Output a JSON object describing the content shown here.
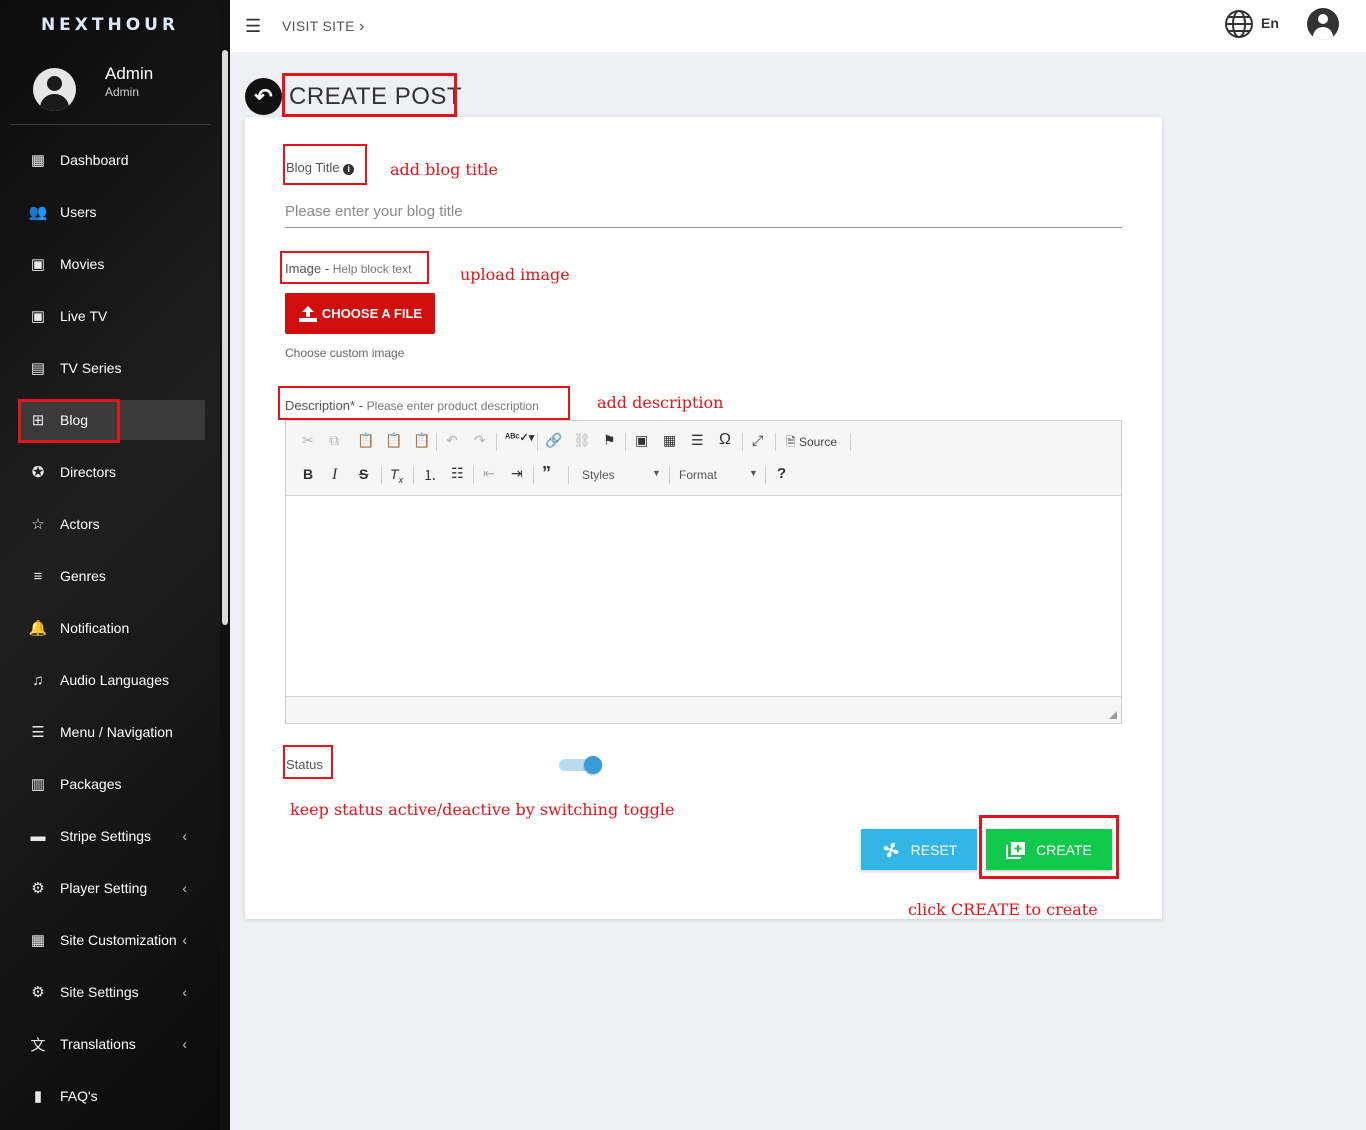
{
  "app": {
    "brand": "NEXTHOUR"
  },
  "profile": {
    "name": "Admin",
    "role": "Admin"
  },
  "sidebar": {
    "items": [
      {
        "label": "Dashboard",
        "icon": "dashboard-icon",
        "glyph": "▦",
        "chevron": false
      },
      {
        "label": "Users",
        "icon": "users-icon",
        "glyph": "👥",
        "chevron": false
      },
      {
        "label": "Movies",
        "icon": "movies-icon",
        "glyph": "▣",
        "chevron": false
      },
      {
        "label": "Live TV",
        "icon": "live-tv-icon",
        "glyph": "▣",
        "chevron": false
      },
      {
        "label": "TV Series",
        "icon": "tv-series-icon",
        "glyph": "▤",
        "chevron": false
      },
      {
        "label": "Blog",
        "icon": "blog-icon",
        "glyph": "⊞",
        "chevron": false,
        "active": true
      },
      {
        "label": "Directors",
        "icon": "directors-icon",
        "glyph": "✪",
        "chevron": false
      },
      {
        "label": "Actors",
        "icon": "actors-icon",
        "glyph": "☆",
        "chevron": false
      },
      {
        "label": "Genres",
        "icon": "genres-icon",
        "glyph": "≡",
        "chevron": false
      },
      {
        "label": "Notification",
        "icon": "notification-icon",
        "glyph": "🔔",
        "chevron": false
      },
      {
        "label": "Audio Languages",
        "icon": "audio-languages-icon",
        "glyph": "♫",
        "chevron": false
      },
      {
        "label": "Menu / Navigation",
        "icon": "menu-icon",
        "glyph": "☰",
        "chevron": false
      },
      {
        "label": "Packages",
        "icon": "packages-icon",
        "glyph": "▥",
        "chevron": false
      },
      {
        "label": "Stripe Settings",
        "icon": "stripe-icon",
        "glyph": "▬",
        "chevron": true
      },
      {
        "label": "Player Setting",
        "icon": "player-gear-icon",
        "glyph": "⚙",
        "chevron": true
      },
      {
        "label": "Site Customization",
        "icon": "site-customization-icon",
        "glyph": "▦",
        "chevron": true
      },
      {
        "label": "Site Settings",
        "icon": "site-gear-icon",
        "glyph": "⚙",
        "chevron": true
      },
      {
        "label": "Translations",
        "icon": "translate-icon",
        "glyph": "文",
        "chevron": true
      },
      {
        "label": "FAQ's",
        "icon": "faq-icon",
        "glyph": "▮",
        "chevron": false
      }
    ],
    "chevron_glyph": "‹"
  },
  "topbar": {
    "visit_site": "VISIT SITE",
    "visit_chevron": "›",
    "language": "En"
  },
  "page": {
    "title": "CREATE POST"
  },
  "form": {
    "blog_title_label": "Blog Title",
    "blog_title_placeholder": "Please enter your blog title",
    "image_label": "Image",
    "image_help_sep": " - ",
    "image_help": "Help block text",
    "file_button": "CHOOSE A FILE",
    "file_help": "Choose custom image",
    "description_label": "Description*",
    "description_help_sep": " - ",
    "description_help": "Please enter product description",
    "status_label": "Status",
    "status_active": true,
    "reset_label": "RESET",
    "create_label": "CREATE"
  },
  "editor": {
    "source_label": "Source",
    "styles_label": "Styles",
    "format_label": "Format",
    "help_glyph": "?"
  },
  "annotations": {
    "blog_title": "add blog title",
    "image": "upload image",
    "description": "add description",
    "status": "keep status active/deactive by switching toggle",
    "create": "click CREATE to create"
  },
  "colors": {
    "accent_red": "#e3141b",
    "reset_blue": "#33b5e5",
    "create_green": "#10c94b",
    "file_red": "#d10d0d"
  }
}
